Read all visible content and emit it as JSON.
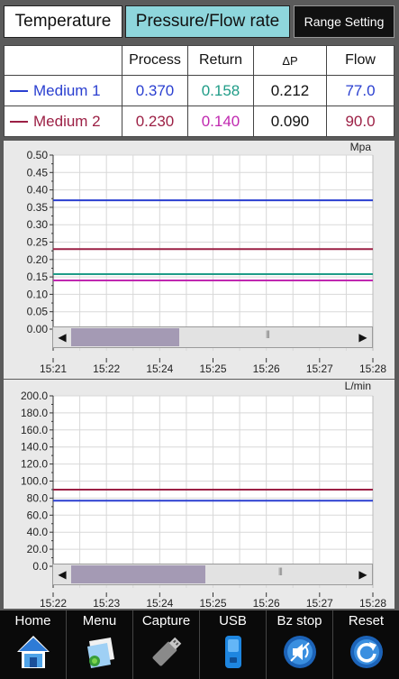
{
  "tabs": {
    "temperature": "Temperature",
    "pressure_flow": "Pressure/Flow rate",
    "range_setting": "Range Setting"
  },
  "table": {
    "headers": [
      "",
      "Process",
      "Return",
      "ΔP",
      "Flow"
    ],
    "rows": [
      {
        "label": "Medium 1",
        "color": "#2a3fd0",
        "process": "0.370",
        "return": "0.158",
        "dp": "0.212",
        "flow": "77.0",
        "process_color": "#2a3fd0",
        "return_color": "#1f9c87",
        "dp_color": "#111111",
        "flow_color": "#2a3fd0"
      },
      {
        "label": "Medium 2",
        "color": "#9c2045",
        "process": "0.230",
        "return": "0.140",
        "dp": "0.090",
        "flow": "90.0",
        "process_color": "#9c2045",
        "return_color": "#c028b0",
        "dp_color": "#111111",
        "flow_color": "#9c2045"
      }
    ]
  },
  "pressure_chart": {
    "unit": "Mpa",
    "x_ticks": [
      "15:21",
      "15:22",
      "15:24",
      "15:25",
      "15:26",
      "15:27",
      "15:28"
    ]
  },
  "flow_chart": {
    "unit": "L/min",
    "x_ticks": [
      "15:22",
      "15:23",
      "15:24",
      "15:25",
      "15:26",
      "15:27",
      "15:28"
    ]
  },
  "chart_data": [
    {
      "type": "line",
      "ylabel": "Mpa",
      "ylim": [
        0,
        0.5
      ],
      "y_ticks": [
        "0.50",
        "0.45",
        "0.40",
        "0.35",
        "0.30",
        "0.25",
        "0.20",
        "0.15",
        "0.10",
        "0.05",
        "0.00"
      ],
      "y_tick_values": [
        0.5,
        0.45,
        0.4,
        0.35,
        0.3,
        0.25,
        0.2,
        0.15,
        0.1,
        0.05,
        0.0
      ],
      "x": [
        "15:21",
        "15:22",
        "15:24",
        "15:25",
        "15:26",
        "15:27",
        "15:28"
      ],
      "grid": true,
      "series": [
        {
          "value": 0.37,
          "color": "#2a3fd0"
        },
        {
          "value": 0.23,
          "color": "#9c2045"
        },
        {
          "value": 0.158,
          "color": "#1f9c87"
        },
        {
          "value": 0.14,
          "color": "#c028b0"
        }
      ]
    },
    {
      "type": "line",
      "ylabel": "L/min",
      "ylim": [
        0,
        200
      ],
      "y_ticks": [
        "200.0",
        "180.0",
        "160.0",
        "140.0",
        "120.0",
        "100.0",
        "80.0",
        "60.0",
        "40.0",
        "20.0",
        "0.0"
      ],
      "y_tick_values": [
        200,
        180,
        160,
        140,
        120,
        100,
        80,
        60,
        40,
        20,
        0
      ],
      "x": [
        "15:22",
        "15:23",
        "15:24",
        "15:25",
        "15:26",
        "15:27",
        "15:28"
      ],
      "grid": true,
      "series": [
        {
          "value": 90.0,
          "color": "#9c2045"
        },
        {
          "value": 77.0,
          "color": "#2a3fd0"
        }
      ]
    }
  ],
  "scrollbars": {
    "pressure": {
      "left_arrow": "◀",
      "right_arrow": "▶",
      "grip": "⦀",
      "position_fraction": 0.0,
      "visible_fraction": 0.38
    },
    "flow": {
      "left_arrow": "◀",
      "right_arrow": "▶",
      "grip": "⦀",
      "position_fraction": 0.0,
      "visible_fraction": 0.47
    }
  },
  "nav": [
    {
      "label": "Home",
      "icon": "home-icon"
    },
    {
      "label": "Menu",
      "icon": "menu-icon"
    },
    {
      "label": "Capture",
      "icon": "usb-stick-icon"
    },
    {
      "label": "USB",
      "icon": "usb-drive-icon"
    },
    {
      "label": "Bz stop",
      "icon": "buzzer-stop-icon"
    },
    {
      "label": "Reset",
      "icon": "reset-icon"
    }
  ]
}
